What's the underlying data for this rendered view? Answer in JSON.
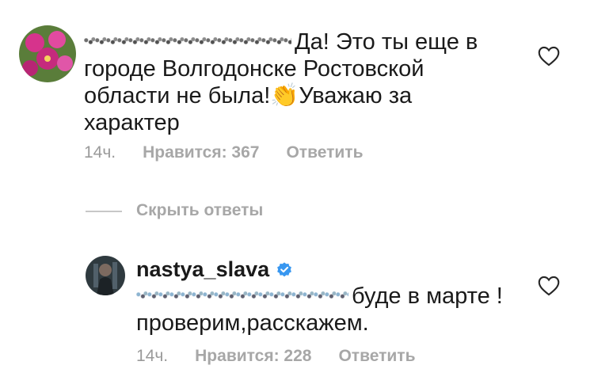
{
  "comment1": {
    "text_line1": "Да! Это ты еще в",
    "text_rest": "городе Волгодонске Ростовской области не была!",
    "emoji": "👏",
    "text_end": "Уважаю за характер",
    "meta": {
      "time": "14ч.",
      "likes": "Нравится: 367",
      "reply": "Ответить"
    }
  },
  "replies_toggle": {
    "label": "Скрыть ответы"
  },
  "comment2": {
    "username": "nastya_slava",
    "verified": true,
    "text_line1": "буде в",
    "text_rest": "марте !проверим,расскажем.",
    "meta": {
      "time": "14ч.",
      "likes": "Нравится: 228",
      "reply": "Ответить"
    }
  },
  "colors": {
    "verified_badge": "#3897f0",
    "muted": "#9a9a9a"
  }
}
